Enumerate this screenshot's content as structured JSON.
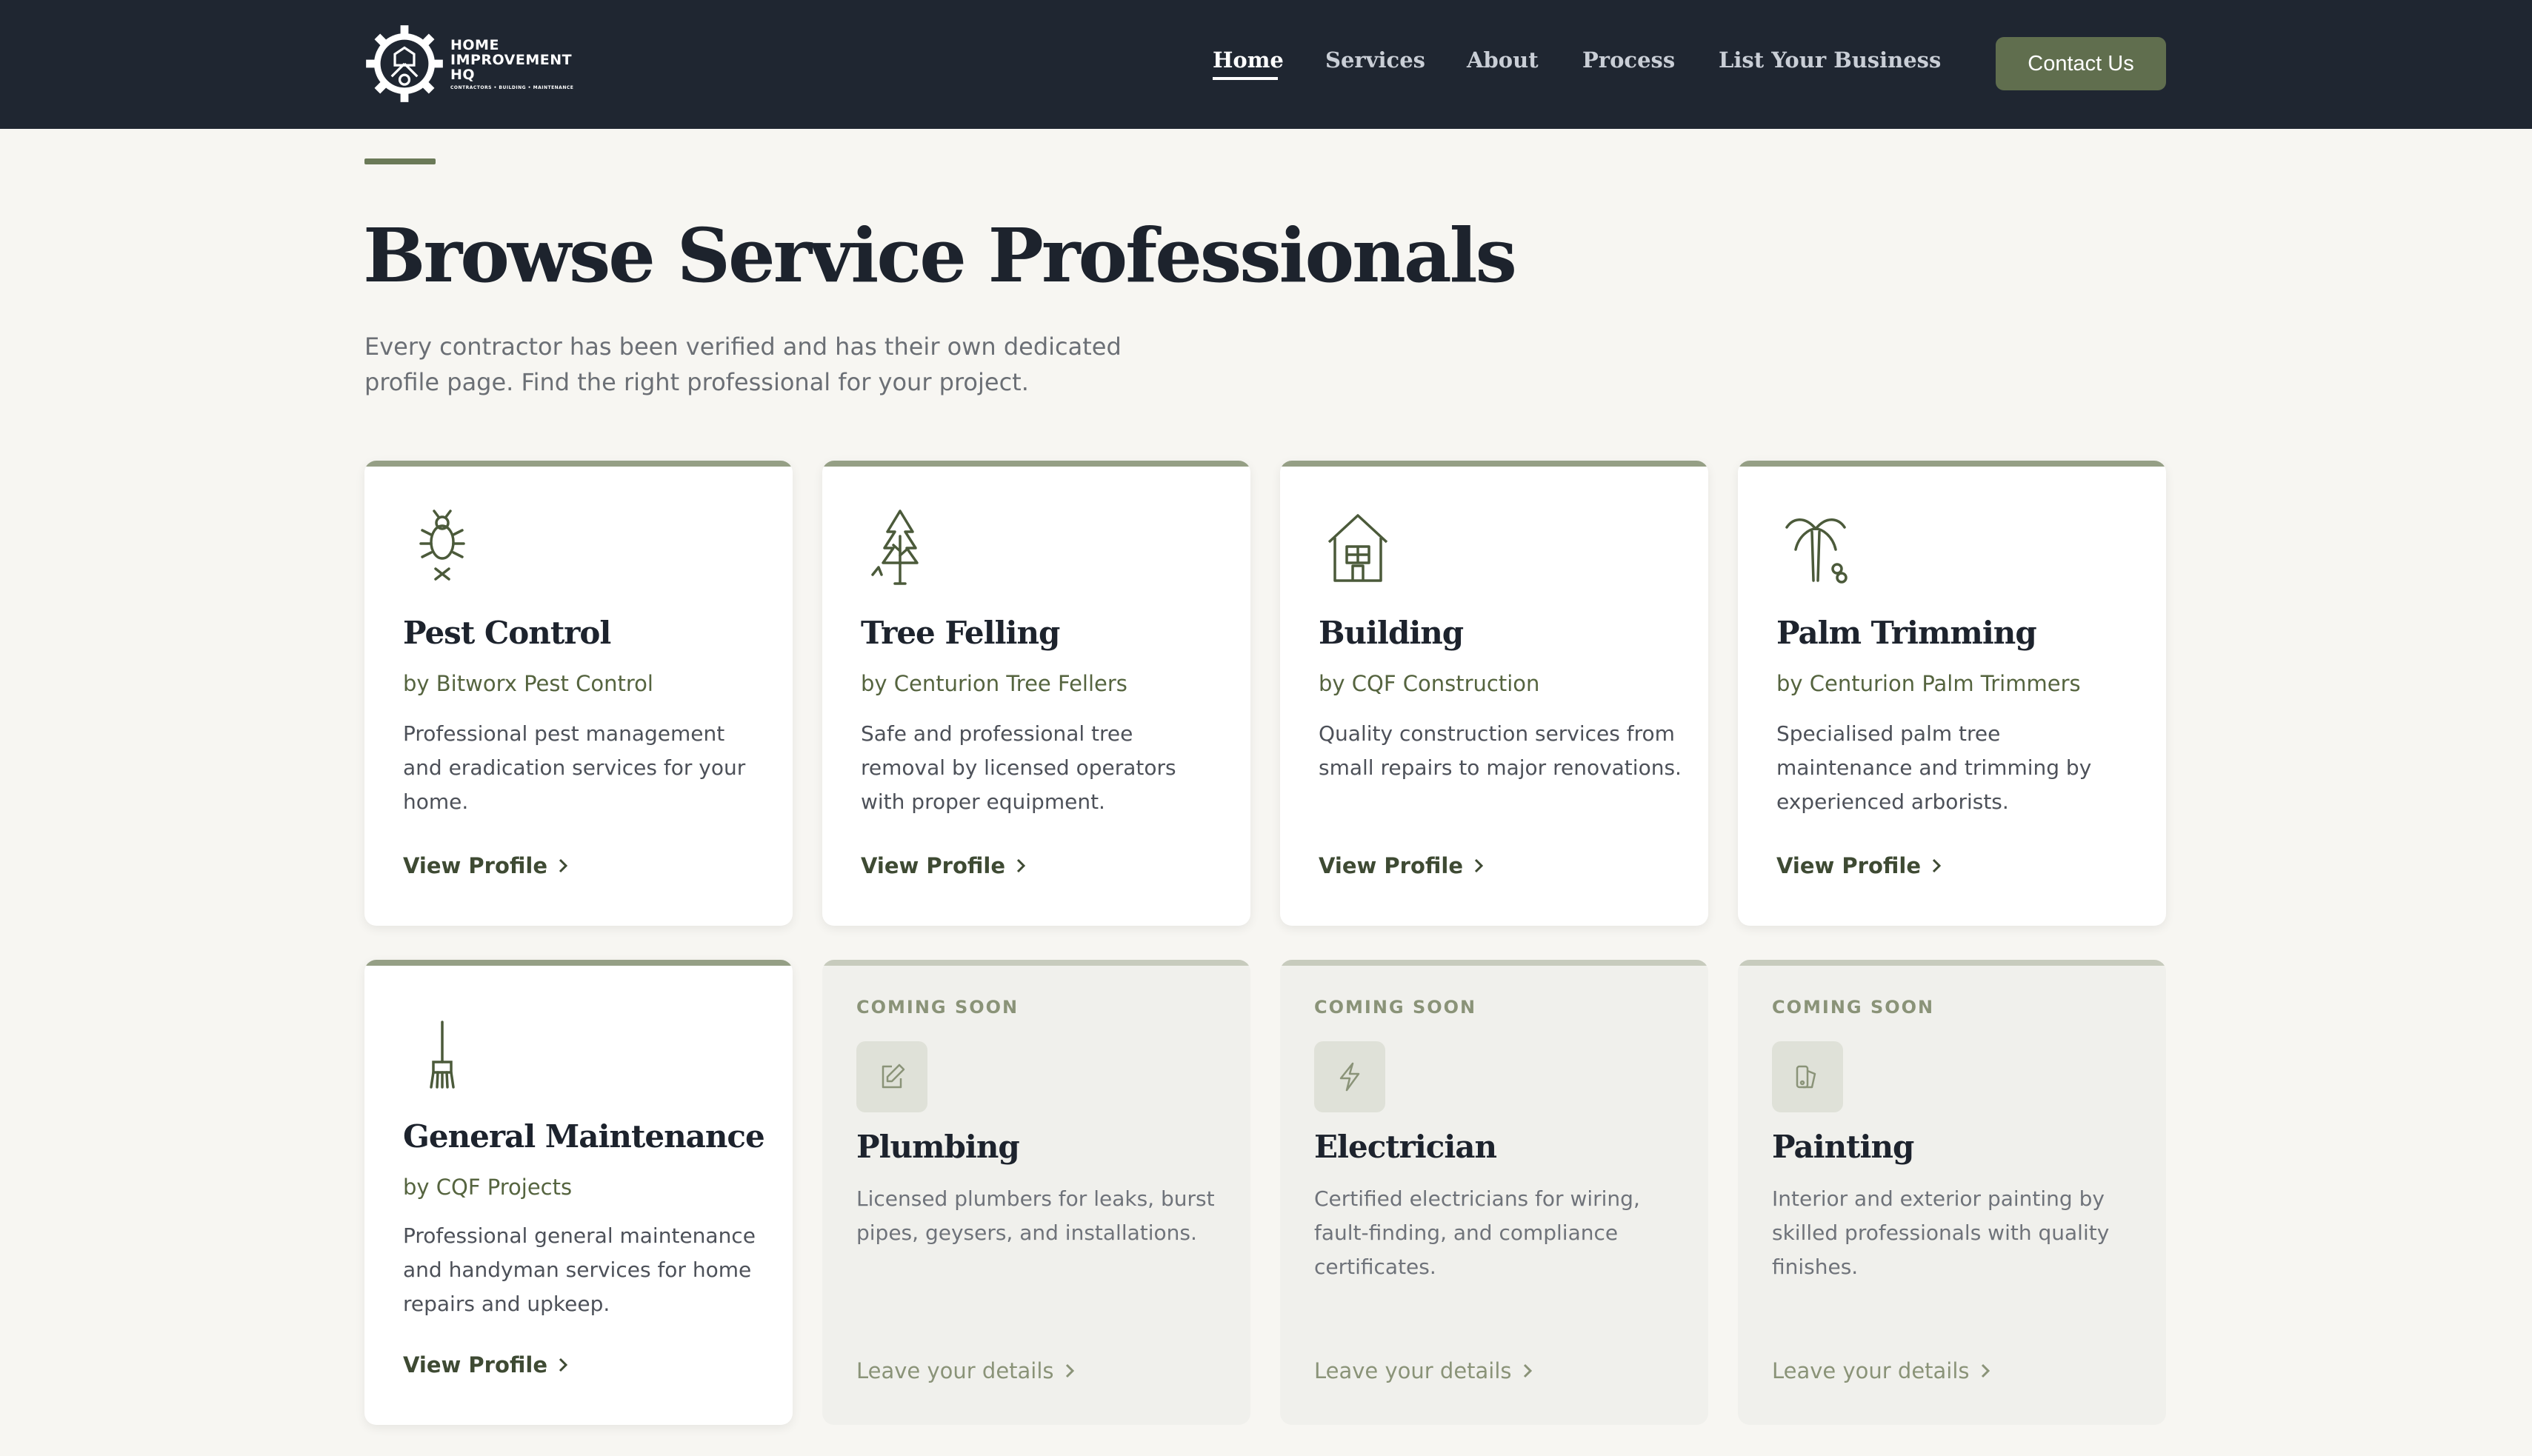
{
  "nav": {
    "logo": {
      "line1": "HOME",
      "line2": "IMPROVEMENT",
      "line3": "HQ",
      "tagline": "CONTRACTORS • BUILDING • MAINTENANCE"
    },
    "links": [
      "Home",
      "Services",
      "About",
      "Process",
      "List Your Business"
    ],
    "contact_label": "Contact Us"
  },
  "header": {
    "title": "Browse Service Professionals",
    "subtitle": "Every contractor has been verified and has their own dedicated profile page. Find the right professional for your project."
  },
  "cards": [
    {
      "title": "Pest Control",
      "by": "by Bitworx Pest Control",
      "desc": "Professional pest management and eradication services for your home.",
      "link": "View Profile",
      "icon": "bug-icon"
    },
    {
      "title": "Tree Felling",
      "by": "by Centurion Tree Fellers",
      "desc": "Safe and professional tree removal by licensed operators with proper equipment.",
      "link": "View Profile",
      "icon": "tree-icon"
    },
    {
      "title": "Building",
      "by": "by CQF Construction",
      "desc": "Quality construction services from small repairs to major renovations.",
      "link": "View Profile",
      "icon": "house-icon"
    },
    {
      "title": "Palm Trimming",
      "by": "by Centurion Palm Trimmers",
      "desc": "Specialised palm tree maintenance and trimming by experienced arborists.",
      "link": "View Profile",
      "icon": "palm-tree-icon"
    },
    {
      "title": "General Maintenance",
      "by": "by CQF Projects",
      "desc": "Professional general maintenance and handyman services for home repairs and upkeep.",
      "link": "View Profile",
      "icon": "brush-icon"
    }
  ],
  "coming_soon": [
    {
      "badge": "COMING SOON",
      "title": "Plumbing",
      "desc": "Licensed plumbers for leaks, burst pipes, geysers, and installations.",
      "link": "Leave your details",
      "icon": "edit-icon"
    },
    {
      "badge": "COMING SOON",
      "title": "Electrician",
      "desc": "Certified electricians for wiring, fault-finding, and compliance certificates.",
      "link": "Leave your details",
      "icon": "lightning-icon"
    },
    {
      "badge": "COMING SOON",
      "title": "Painting",
      "desc": "Interior and exterior painting by skilled professionals with quality finishes.",
      "link": "Leave your details",
      "icon": "paint-swatch-icon"
    }
  ],
  "colors": {
    "nav_bg": "#1f2631",
    "accent": "#606e4e",
    "page_bg": "#f7f6f2"
  }
}
